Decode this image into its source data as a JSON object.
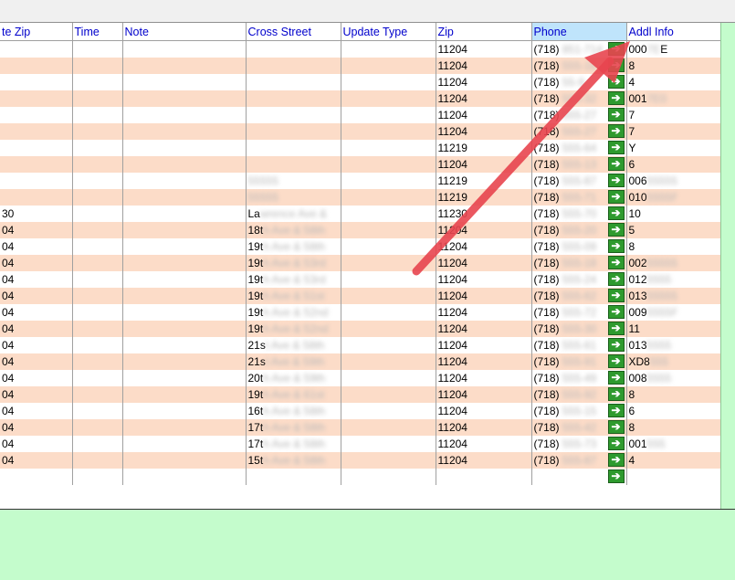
{
  "columns": [
    "te Zip",
    "Time",
    "Note",
    "Cross Street",
    "Update Type",
    "Zip",
    "Phone",
    "Addl Info"
  ],
  "go_glyph": "➔",
  "colors": {
    "row_alt": "#fcdcc8",
    "header_text": "#0000cc",
    "sorted_header": "#bfe4fb",
    "background": "#c4fccc",
    "go_button": "#2e9a2e",
    "annotation_arrow": "#e8454f"
  },
  "rows": [
    {
      "te_zip": "",
      "cross": "",
      "cross_blur": "",
      "zip": "11204",
      "area": "(718)",
      "phone_blur": "851-714",
      "addl": "000",
      "addl_blur": "7E",
      "addl_tail": "E"
    },
    {
      "te_zip": "",
      "cross": "",
      "cross_blur": "",
      "zip": "11204",
      "area": "(718)",
      "phone_blur": "555-18",
      "addl": "8",
      "addl_blur": "",
      "addl_tail": ""
    },
    {
      "te_zip": "",
      "cross": "",
      "cross_blur": "",
      "zip": "11204",
      "area": "(718)",
      "phone_blur": "55-9",
      "addl": "4",
      "addl_blur": "",
      "addl_tail": ""
    },
    {
      "te_zip": "",
      "cross": "",
      "cross_blur": "",
      "zip": "11204",
      "area": "(718)",
      "phone_blur": "555-32",
      "addl": "001",
      "addl_blur": "7E0",
      "addl_tail": ""
    },
    {
      "te_zip": "",
      "cross": "",
      "cross_blur": "",
      "zip": "11204",
      "area": "(718)",
      "phone_blur": "555-27",
      "addl": "7",
      "addl_blur": "",
      "addl_tail": ""
    },
    {
      "te_zip": "",
      "cross": "",
      "cross_blur": "",
      "zip": "11204",
      "area": "(718)",
      "phone_blur": "555-27",
      "addl": "7",
      "addl_blur": "",
      "addl_tail": ""
    },
    {
      "te_zip": "",
      "cross": "",
      "cross_blur": "",
      "zip": "11219",
      "area": "(718)",
      "phone_blur": "555-64",
      "addl": "Y",
      "addl_blur": "",
      "addl_tail": ""
    },
    {
      "te_zip": "",
      "cross": "",
      "cross_blur": "",
      "zip": "11204",
      "area": "(718)",
      "phone_blur": "555-13",
      "addl": "6",
      "addl_blur": "",
      "addl_tail": ""
    },
    {
      "te_zip": "",
      "cross": "",
      "cross_blur": "55555",
      "zip": "11219",
      "area": "(718)",
      "phone_blur": "555-87",
      "addl": "006",
      "addl_blur": "55555",
      "addl_tail": ""
    },
    {
      "te_zip": "",
      "cross": "",
      "cross_blur": "55555",
      "zip": "11219",
      "area": "(718)",
      "phone_blur": "555-71",
      "addl": "010",
      "addl_blur": "5555F",
      "addl_tail": ""
    },
    {
      "te_zip": "30",
      "cross": "La",
      "cross_blur": "wrence Ave &",
      "zip": "11230",
      "area": "(718)",
      "phone_blur": "555-70",
      "addl": "10",
      "addl_blur": "",
      "addl_tail": ""
    },
    {
      "te_zip": "04",
      "cross": "18t",
      "cross_blur": "h Ave & 58th",
      "zip": "11204",
      "area": "(718)",
      "phone_blur": "555-20",
      "addl": "5",
      "addl_blur": "",
      "addl_tail": ""
    },
    {
      "te_zip": "04",
      "cross": "19t",
      "cross_blur": "h Ave & 58th",
      "zip": "11204",
      "area": "(718)",
      "phone_blur": "555-09",
      "addl": "8",
      "addl_blur": "",
      "addl_tail": ""
    },
    {
      "te_zip": "04",
      "cross": "19t",
      "cross_blur": "h Ave & 53rd",
      "zip": "11204",
      "area": "(718)",
      "phone_blur": "555-18",
      "addl": "002",
      "addl_blur": "55555",
      "addl_tail": ""
    },
    {
      "te_zip": "04",
      "cross": "19t",
      "cross_blur": "h Ave & 53rd",
      "zip": "11204",
      "area": "(718)",
      "phone_blur": "555-24",
      "addl": "012",
      "addl_blur": "5555",
      "addl_tail": ""
    },
    {
      "te_zip": "04",
      "cross": "19t",
      "cross_blur": "h Ave & 51st",
      "zip": "11204",
      "area": "(718)",
      "phone_blur": "555-62",
      "addl": "013",
      "addl_blur": "55555",
      "addl_tail": ""
    },
    {
      "te_zip": "04",
      "cross": "19t",
      "cross_blur": "h Ave & 52nd",
      "zip": "11204",
      "area": "(718)",
      "phone_blur": "555-72",
      "addl": "009",
      "addl_blur": "5555F",
      "addl_tail": ""
    },
    {
      "te_zip": "04",
      "cross": "19t",
      "cross_blur": "h Ave & 52nd",
      "zip": "11204",
      "area": "(718)",
      "phone_blur": "555-30",
      "addl": "11",
      "addl_blur": "",
      "addl_tail": ""
    },
    {
      "te_zip": "04",
      "cross": "21s",
      "cross_blur": "t Ave & 58th",
      "zip": "11204",
      "area": "(718)",
      "phone_blur": "555-61",
      "addl": "013",
      "addl_blur": "5555",
      "addl_tail": ""
    },
    {
      "te_zip": "04",
      "cross": "21s",
      "cross_blur": "t Ave & 59th",
      "zip": "11204",
      "area": "(718)",
      "phone_blur": "555-91",
      "addl": "XD8",
      "addl_blur": "555",
      "addl_tail": ""
    },
    {
      "te_zip": "04",
      "cross": "20t",
      "cross_blur": "h Ave & 59th",
      "zip": "11204",
      "area": "(718)",
      "phone_blur": "555-49",
      "addl": "008",
      "addl_blur": "5555",
      "addl_tail": ""
    },
    {
      "te_zip": "04",
      "cross": "19t",
      "cross_blur": "h Ave & 61st",
      "zip": "11204",
      "area": "(718)",
      "phone_blur": "555-92",
      "addl": "8",
      "addl_blur": "",
      "addl_tail": ""
    },
    {
      "te_zip": "04",
      "cross": "16t",
      "cross_blur": "h Ave & 58th",
      "zip": "11204",
      "area": "(718)",
      "phone_blur": "555-15",
      "addl": "6",
      "addl_blur": "",
      "addl_tail": ""
    },
    {
      "te_zip": "04",
      "cross": "17t",
      "cross_blur": "h Ave & 58th",
      "zip": "11204",
      "area": "(718)",
      "phone_blur": "555-42",
      "addl": "8",
      "addl_blur": "",
      "addl_tail": ""
    },
    {
      "te_zip": "04",
      "cross": "17t",
      "cross_blur": "h Ave & 58th",
      "zip": "11204",
      "area": "(718)",
      "phone_blur": "555-73",
      "addl": "001",
      "addl_blur": "555",
      "addl_tail": ""
    },
    {
      "te_zip": "04",
      "cross": "15t",
      "cross_blur": "h Ave & 58th",
      "zip": "11204",
      "area": "(718)",
      "phone_blur": "555-87",
      "addl": "4",
      "addl_blur": "",
      "addl_tail": ""
    },
    {
      "te_zip": "",
      "cross": "",
      "cross_blur": "",
      "zip": "",
      "area": "",
      "phone_blur": "",
      "addl": "",
      "addl_blur": "",
      "addl_tail": ""
    }
  ]
}
